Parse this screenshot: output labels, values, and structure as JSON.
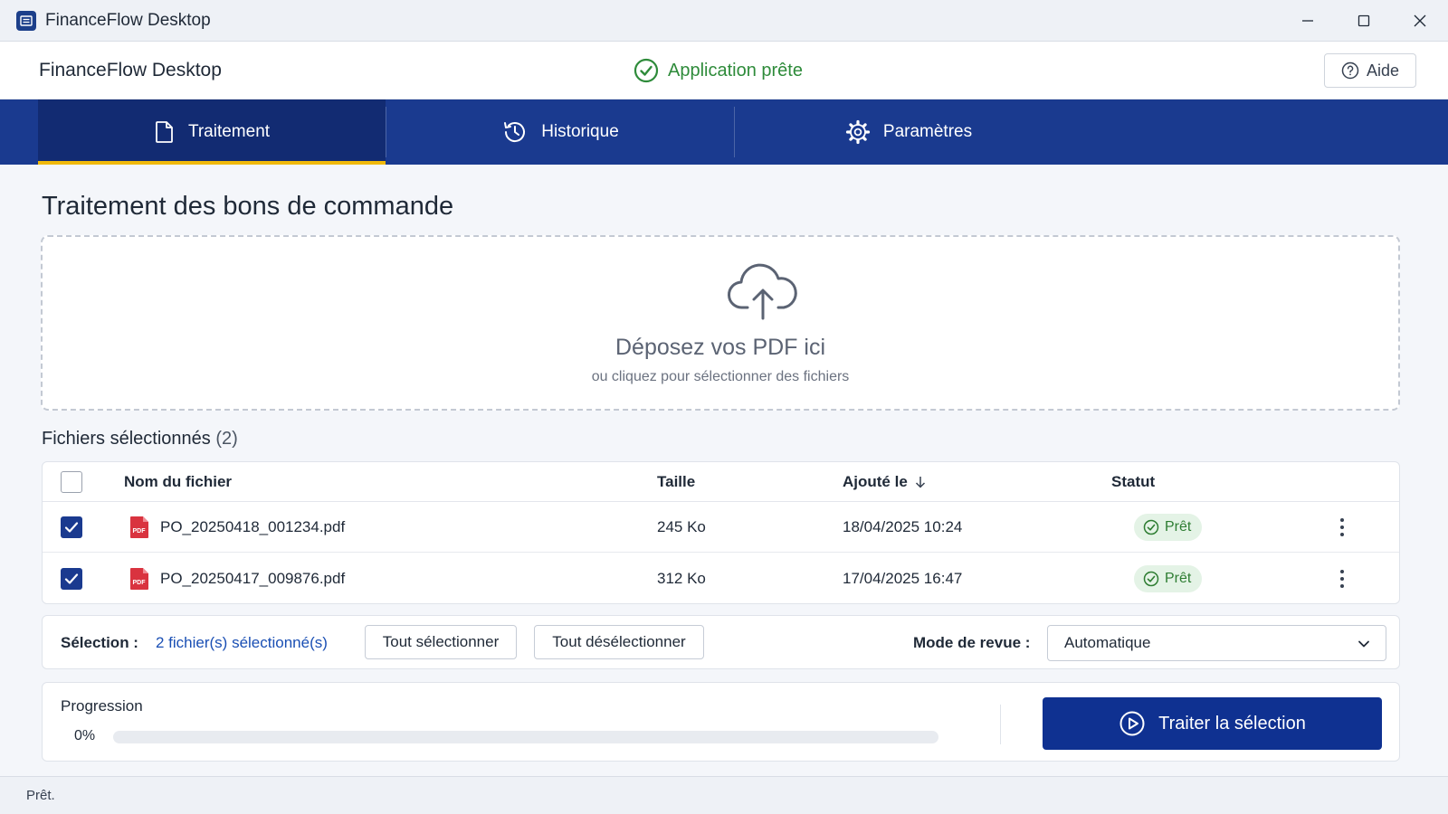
{
  "window": {
    "title": "FinanceFlow Desktop",
    "icons": {
      "app": "app-icon",
      "minimize": "minimize-icon",
      "maximize": "maximize-icon",
      "close": "close-icon"
    }
  },
  "header": {
    "app_name": "FinanceFlow Desktop",
    "status_text": "Application prête",
    "status_icon": "check-circle-icon",
    "help_label": "Aide",
    "help_icon": "help-circle-icon"
  },
  "tabs": [
    {
      "label": "Traitement",
      "icon": "document-icon",
      "active": true
    },
    {
      "label": "Historique",
      "icon": "history-icon",
      "active": false
    },
    {
      "label": "Paramètres",
      "icon": "gear-icon",
      "active": false
    }
  ],
  "main": {
    "title": "Traitement des bons de commande",
    "dropzone": {
      "icon": "cloud-upload-icon",
      "title": "Déposez vos PDF ici",
      "subtitle": "ou cliquez pour sélectionner des fichiers"
    },
    "files_heading": "Fichiers sélectionnés",
    "files_count": "(2)",
    "table": {
      "columns": [
        "Nom du fichier",
        "Taille",
        "Ajouté le",
        "Statut"
      ],
      "sort_icon": "arrow-down-icon",
      "rows": [
        {
          "checked": true,
          "name": "PO_20250418_001234.pdf",
          "size": "245 Ko",
          "added": "18/04/2025 10:24",
          "status": "Prêt"
        },
        {
          "checked": true,
          "name": "PO_20250417_009876.pdf",
          "size": "312 Ko",
          "added": "17/04/2025 16:47",
          "status": "Prêt"
        }
      ]
    },
    "selection": {
      "label": "Sélection :",
      "summary": "2 fichier(s) sélectionné(s)",
      "select_all": "Tout sélectionner",
      "deselect_all": "Tout désélectionner",
      "mode_label": "Mode de revue :",
      "mode_value": "Automatique"
    },
    "progress": {
      "label": "Progression",
      "percent_text": "0%",
      "value": 0,
      "button_label": "Traiter la sélection",
      "button_icon": "play-circle-icon"
    }
  },
  "statusbar": {
    "text": "Prêt."
  },
  "colors": {
    "primary": "#1a3a8f",
    "tab_active": "#122b72",
    "tab_underline": "#f0b90b",
    "success": "#2e8b3a",
    "link": "#1a4fb4"
  }
}
